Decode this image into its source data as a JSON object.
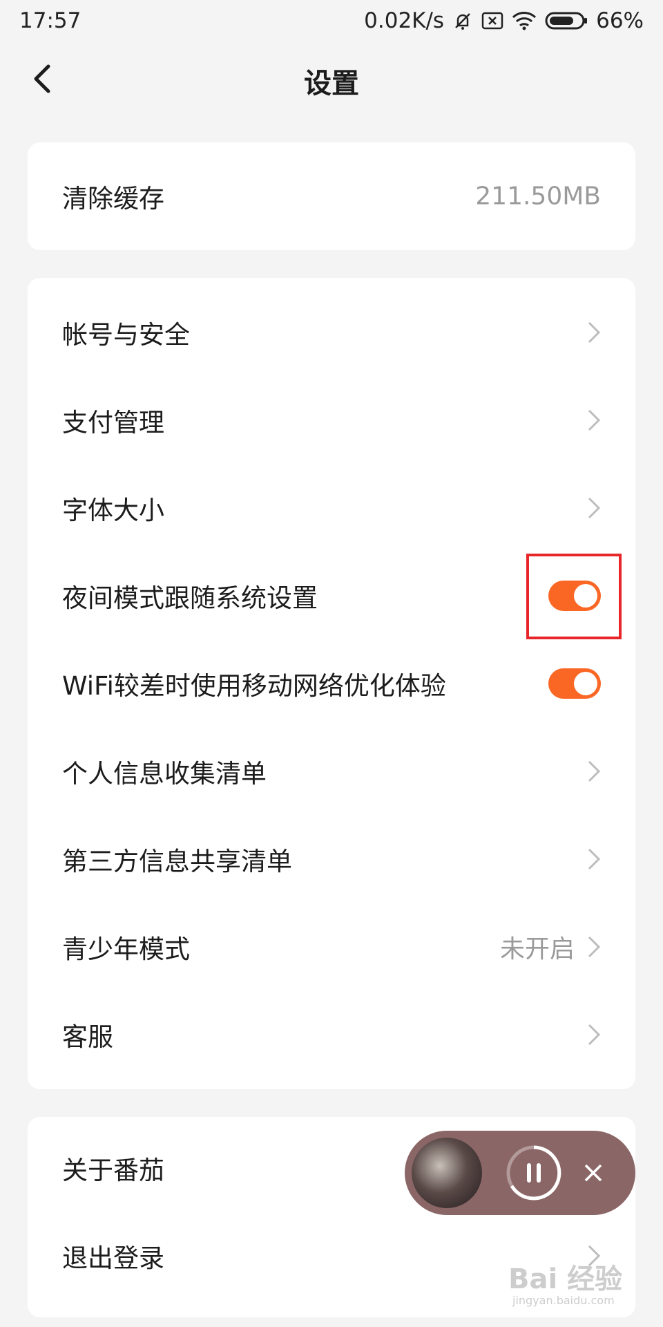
{
  "status_bar": {
    "time": "17:57",
    "network_speed": "0.02K/s",
    "battery": "66%",
    "icons": [
      "mute-bell-icon",
      "sim-x-icon",
      "wifi-icon",
      "battery-icon"
    ]
  },
  "nav": {
    "back_icon": "chevron-left-icon",
    "title": "设置"
  },
  "cache_card": {
    "label": "清除缓存",
    "value": "211.50MB"
  },
  "settings": [
    {
      "label": "帐号与安全",
      "control": "chevron"
    },
    {
      "label": "支付管理",
      "control": "chevron"
    },
    {
      "label": "字体大小",
      "control": "chevron"
    },
    {
      "label": "夜间模式跟随系统设置",
      "control": "toggle",
      "on": true
    },
    {
      "label": "WiFi较差时使用移动网络优化体验",
      "control": "toggle",
      "on": true
    },
    {
      "label": "个人信息收集清单",
      "control": "chevron"
    },
    {
      "label": "第三方信息共享清单",
      "control": "chevron"
    },
    {
      "label": "青少年模式",
      "control": "chevron",
      "value": "未开启"
    },
    {
      "label": "客服",
      "control": "chevron"
    }
  ],
  "bottom_card": [
    {
      "label": "关于番茄"
    },
    {
      "label": "退出登录",
      "control": "chevron"
    }
  ],
  "player": {
    "cover_icon": "audiobook-cover-image",
    "pause_icon": "pause-icon",
    "close_icon": "close-icon"
  },
  "watermark": {
    "text": "Bai 经验",
    "url": "jingyan.baidu.com"
  },
  "colors": {
    "accent": "#fa6725",
    "highlight": "#e8262a",
    "background": "#f4f4f4",
    "card": "#ffffff",
    "player_bg": "#8b6666"
  }
}
